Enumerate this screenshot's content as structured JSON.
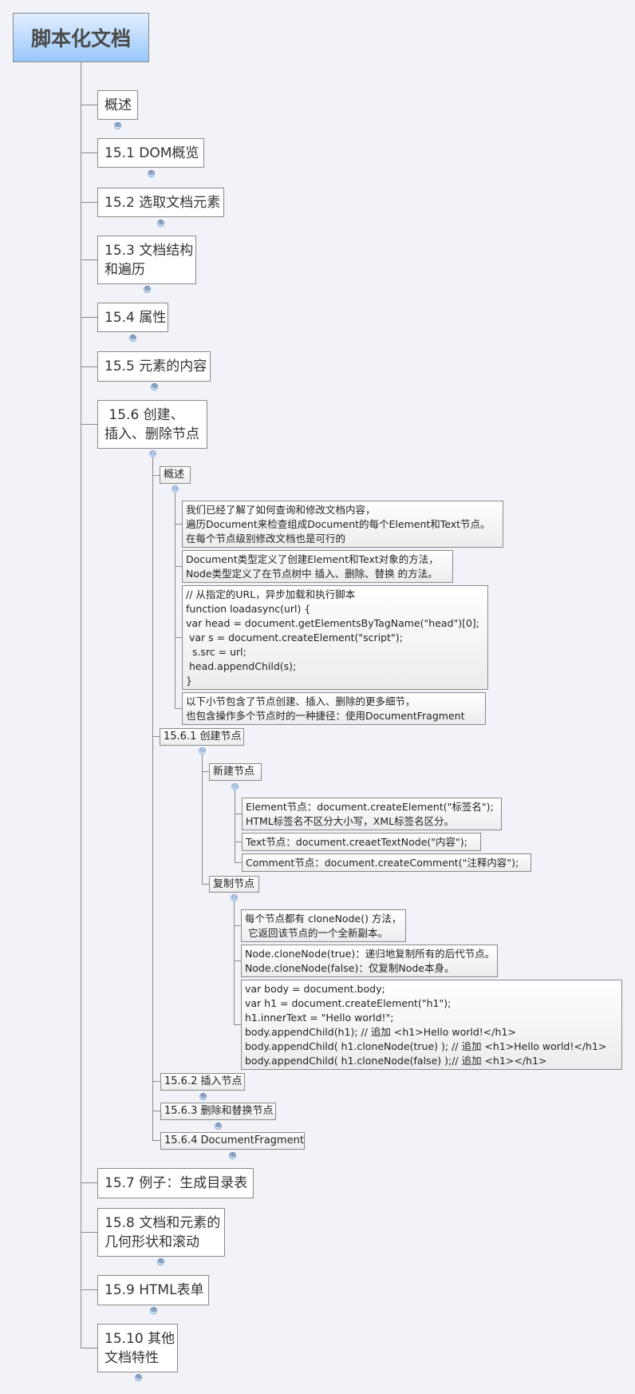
{
  "root": {
    "title": "脚本化文档"
  },
  "topics": [
    {
      "label": "概述",
      "collapsed": true
    },
    {
      "label": "15.1 DOM概览",
      "collapsed": true
    },
    {
      "label": "15.2 选取文档元素",
      "collapsed": true
    },
    {
      "label": "15.3 文档结构\n和遍历",
      "collapsed": true
    },
    {
      "label": "15.4 属性",
      "collapsed": true
    },
    {
      "label": "15.5 元素的内容",
      "collapsed": true
    },
    {
      "label": " 15.6 创建、\n插入、删除节点",
      "collapsed": false
    },
    {
      "label": "15.7 例子：生成目录表",
      "collapsed": false
    },
    {
      "label": "15.8 文档和元素的\n几何形状和滚动",
      "collapsed": true
    },
    {
      "label": "15.9 HTML表单",
      "collapsed": true
    },
    {
      "label": "15.10 其他\n文档特性",
      "collapsed": true
    }
  ],
  "section_15_6": {
    "overview": {
      "label": "概述",
      "notes": [
        "我们已经了解了如何查询和修改文档内容，\n遍历Document来检查组成Document的每个Element和Text节点。\n在每个节点级别修改文档也是可行的",
        "Document类型定义了创建Element和Text对象的方法，\nNode类型定义了在节点树中 插入、删除、替换 的方法。",
        "// 从指定的URL，异步加载和执行脚本\nfunction loadasync(url) {\nvar head = document.getElementsByTagName(\"head\")[0];\n var s = document.createElement(\"script\");\n  s.src = url;\n head.appendChild(s);\n}",
        "以下小节包含了节点创建、插入、删除的更多细节，\n也包含操作多个节点时的一种捷径：使用DocumentFragment"
      ]
    },
    "create_nodes": {
      "label": "15.6.1 创建节点",
      "new_node": {
        "label": "新建节点",
        "notes": [
          "Element节点：document.createElement(\"标签名\");\nHTML标签名不区分大小写，XML标签名区分。",
          "Text节点：document.creaetTextNode(\"内容\");",
          "Comment节点：document.createComment(\"注释内容\");"
        ]
      },
      "clone_node": {
        "label": "复制节点",
        "notes": [
          "每个节点都有 cloneNode() 方法，\n 它返回该节点的一个全新副本。",
          "Node.cloneNode(true)：递归地复制所有的后代节点。\nNode.cloneNode(false)：仅复制Node本身。",
          "var body = document.body;\nvar h1 = document.createElement(\"h1\");\nh1.innerText = \"Hello world!\";\nbody.appendChild(h1); // 追加 <h1>Hello world!</h1>\nbody.appendChild( h1.cloneNode(true) ); // 追加 <h1>Hello world!</h1>\nbody.appendChild( h1.cloneNode(false) );// 追加 <h1></h1>"
        ]
      }
    },
    "insert_nodes": {
      "label": "15.6.2 插入节点",
      "collapsed": true
    },
    "remove_replace": {
      "label": "15.6.3 删除和替换节点",
      "collapsed": true
    },
    "fragment": {
      "label": "15.6.4 DocumentFragment",
      "collapsed": true
    }
  },
  "icons": {
    "expand": "⊕",
    "collapse": "⊖"
  },
  "colors": {
    "background": "#f1f3f8",
    "root_top": "#e2efff",
    "root_bottom": "#98c8fb",
    "line": "#8a8a8a"
  }
}
